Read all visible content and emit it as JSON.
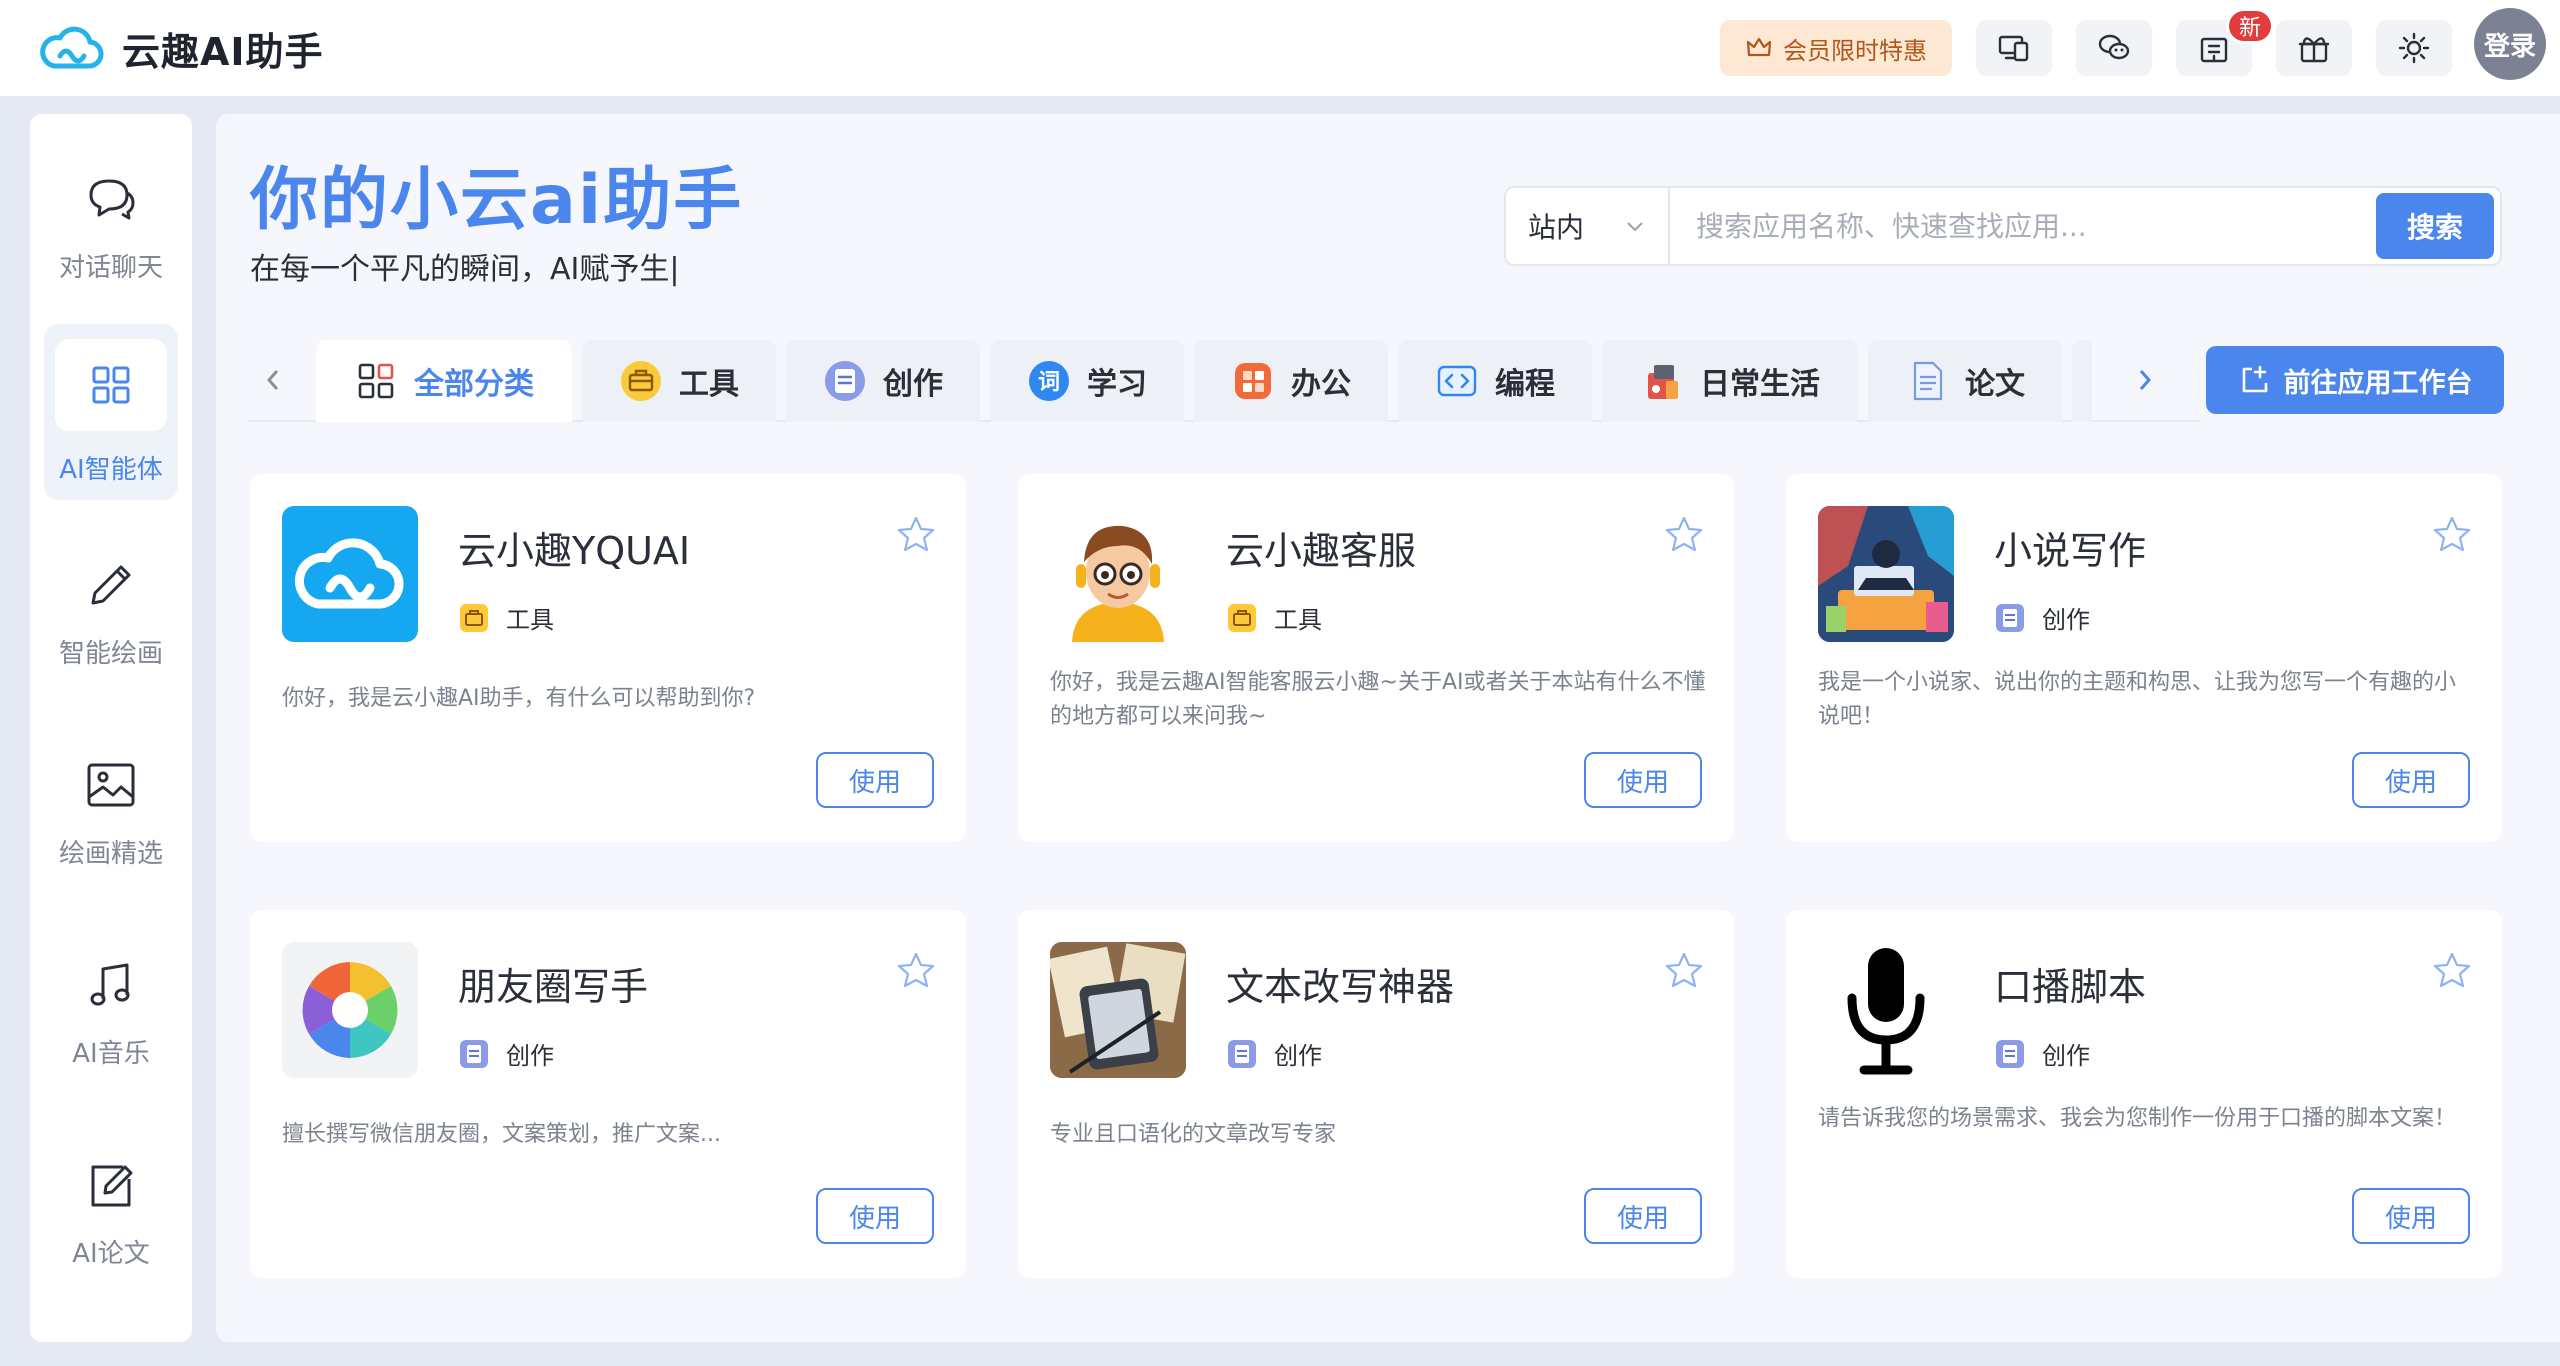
{
  "brand": {
    "name": "云趣AI助手",
    "accent": "#4b86ec"
  },
  "topbar": {
    "vip_label": "会员限时特惠",
    "new_badge": "新",
    "login_label": "登录",
    "icons": [
      "devices-icon",
      "wechat-icon",
      "building-icon",
      "gift-icon",
      "sun-icon"
    ]
  },
  "sidebar": {
    "items": [
      {
        "label": "对话聊天",
        "icon": "chat-icon",
        "active": false
      },
      {
        "label": "AI智能体",
        "icon": "grid-icon",
        "active": true
      },
      {
        "label": "智能绘画",
        "icon": "pencil-icon",
        "active": false
      },
      {
        "label": "绘画精选",
        "icon": "image-icon",
        "active": false
      },
      {
        "label": "AI音乐",
        "icon": "music-icon",
        "active": false
      },
      {
        "label": "AI论文",
        "icon": "edit-icon",
        "active": false
      }
    ]
  },
  "hero": {
    "title": "你的小云ai助手",
    "subtitle": "在每一个平凡的瞬间，AI赋予生|"
  },
  "search": {
    "scope": "站内",
    "placeholder": "搜索应用名称、快速查找应用...",
    "button": "搜索"
  },
  "tabs": [
    {
      "label": "全部分类",
      "icon": "all-category-icon",
      "active": true
    },
    {
      "label": "工具",
      "icon": "toolbox-icon",
      "active": false
    },
    {
      "label": "创作",
      "icon": "create-icon",
      "active": false
    },
    {
      "label": "学习",
      "icon": "study-icon",
      "active": false
    },
    {
      "label": "办公",
      "icon": "office-icon",
      "active": false
    },
    {
      "label": "编程",
      "icon": "code-icon",
      "active": false
    },
    {
      "label": "日常生活",
      "icon": "daily-life-icon",
      "active": false
    },
    {
      "label": "论文",
      "icon": "paper-icon",
      "active": false
    }
  ],
  "goto_workbench": "前往应用工作台",
  "cards": [
    {
      "title": "云小趣YQUAI",
      "tag": "工具",
      "desc": "你好，我是云小趣AI助手，有什么可以帮助到你?",
      "use": "使用"
    },
    {
      "title": "云小趣客服",
      "tag": "工具",
      "desc": "你好，我是云趣AI智能客服云小趣~关于AI或者关于本站有什么不懂的地方都可以来问我~",
      "use": "使用"
    },
    {
      "title": "小说写作",
      "tag": "创作",
      "desc": "我是一个小说家、说出你的主题和构思、让我为您写一个有趣的小说吧！",
      "use": "使用"
    },
    {
      "title": "朋友圈写手",
      "tag": "创作",
      "desc": "擅长撰写微信朋友圈，文案策划，推广文案...",
      "use": "使用"
    },
    {
      "title": "文本改写神器",
      "tag": "创作",
      "desc": "专业且口语化的文章改写专家",
      "use": "使用"
    },
    {
      "title": "口播脚本",
      "tag": "创作",
      "desc": "请告诉我您的场景需求、我会为您制作一份用于口播的脚本文案！",
      "use": "使用"
    }
  ]
}
